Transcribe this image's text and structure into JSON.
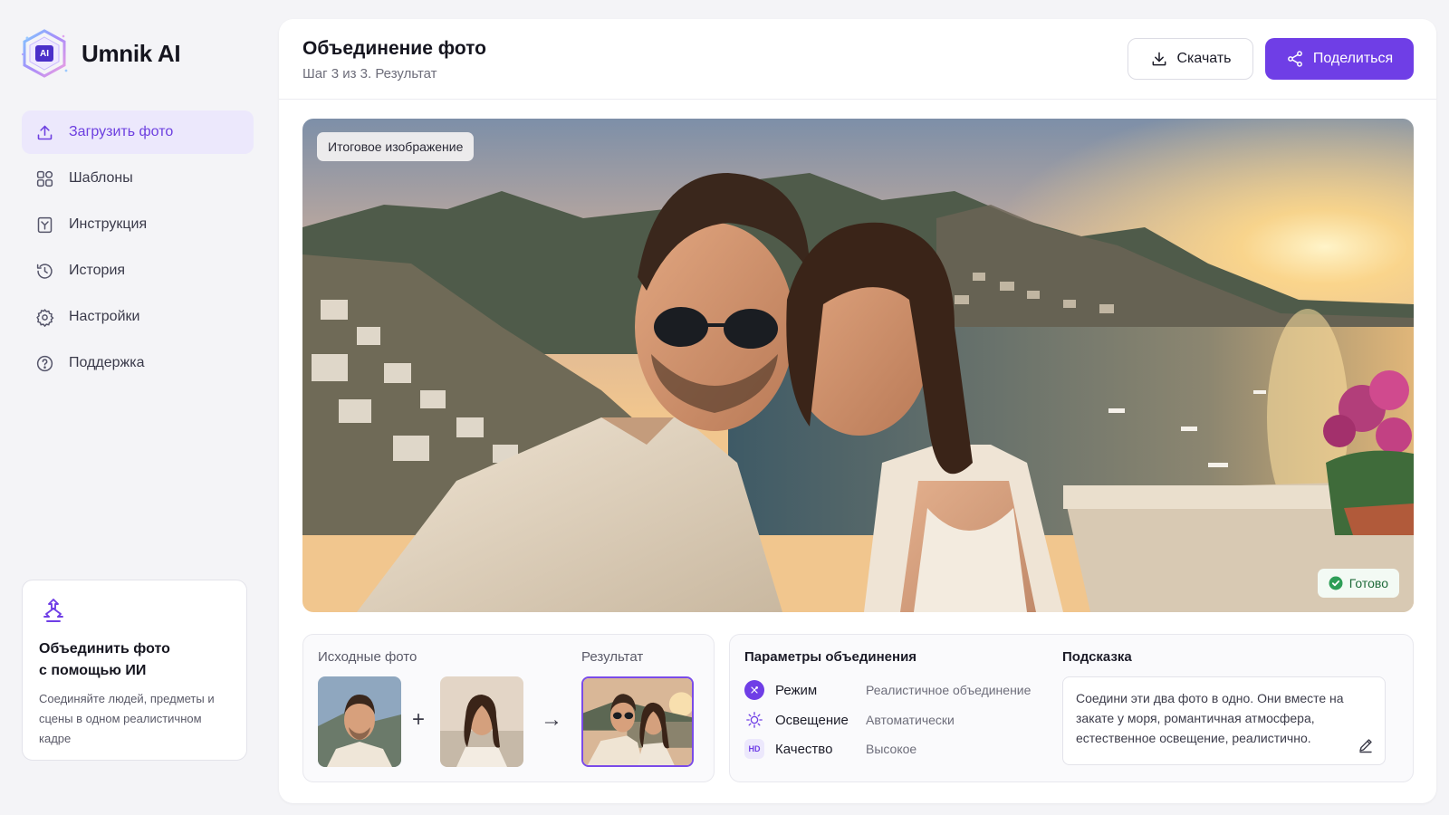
{
  "brand": {
    "name": "Umnik AI",
    "logo_text": "AI"
  },
  "sidebar": {
    "items": [
      {
        "label": "Загрузить фото",
        "icon": "upload-icon",
        "active": true
      },
      {
        "label": "Шаблоны",
        "icon": "templates-icon",
        "active": false
      },
      {
        "label": "Инструкция",
        "icon": "instruction-icon",
        "active": false
      },
      {
        "label": "История",
        "icon": "history-icon",
        "active": false
      },
      {
        "label": "Настройки",
        "icon": "settings-icon",
        "active": false
      },
      {
        "label": "Поддержка",
        "icon": "help-icon",
        "active": false
      }
    ],
    "promo": {
      "title": "Объединить фото\nс помощью ИИ",
      "text": "Соединяйте людей, предметы и сцены в одном реалистичном кадре"
    }
  },
  "header": {
    "title": "Объединение фото",
    "subtitle": "Шаг 3 из 3. Результат",
    "download_label": "Скачать",
    "share_label": "Поделиться"
  },
  "result": {
    "label": "Итоговое изображение",
    "status": "Готово"
  },
  "sources": {
    "label": "Исходные фото",
    "result_label": "Результат",
    "plus": "+",
    "arrow": "→"
  },
  "params": {
    "title": "Параметры объединения",
    "rows": [
      {
        "name": "Режим",
        "value": "Реалистичное объединение",
        "icon": "mode-icon"
      },
      {
        "name": "Освещение",
        "value": "Автоматически",
        "icon": "sun-icon"
      },
      {
        "name": "Качество",
        "value": "Высокое",
        "icon": "hd-icon",
        "icon_text": "HD"
      }
    ]
  },
  "hint": {
    "title": "Подсказка",
    "text": "Соедини эти два фото в одно. Они вместе на закате у моря, романтичная атмосфера, естественное освещение, реалистично."
  },
  "colors": {
    "accent": "#6f3ee6",
    "accent_soft": "#ece8fc",
    "ready": "#2e9e57"
  }
}
